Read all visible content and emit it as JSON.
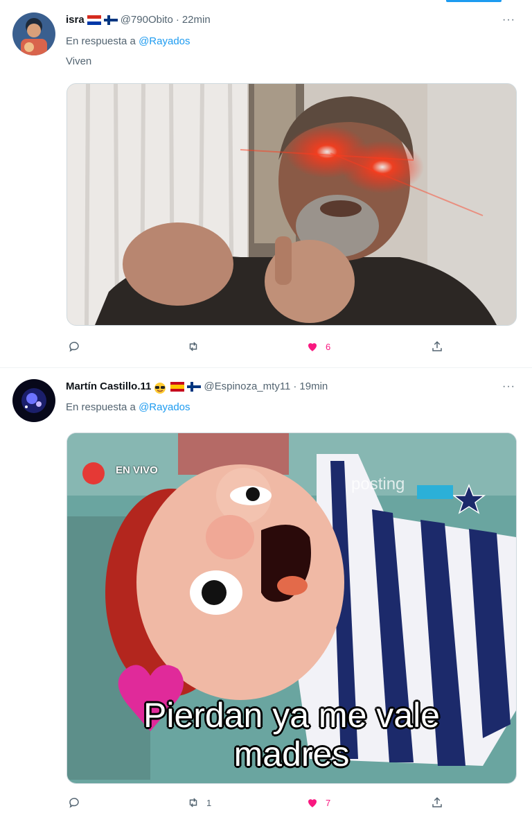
{
  "tweets": [
    {
      "name": "isra",
      "handle": "@790Obito",
      "time": "22min",
      "reply_prefix": "En respuesta a",
      "reply_to": "@Rayados",
      "text": "Viven",
      "more": "···",
      "actions": {
        "reply": "",
        "retweet": "",
        "like": "6",
        "liked": true,
        "share": ""
      }
    },
    {
      "name": "Martín Castillo.11",
      "handle": "@Espinoza_mty11",
      "time": "19min",
      "reply_prefix": "En respuesta a",
      "reply_to": "@Rayados",
      "more": "···",
      "media_caption_line1": "Pierdan ya me vale",
      "media_caption_line2": "madres",
      "media_badge": "EN VIVO",
      "media_watermark": "posting",
      "actions": {
        "reply": "",
        "retweet": "1",
        "like": "7",
        "liked": true,
        "share": ""
      }
    }
  ],
  "colors": {
    "accent": "#1d9bf0",
    "like": "#f91880",
    "muted": "#536471"
  },
  "icons": [
    "reply-icon",
    "retweet-icon",
    "like-icon",
    "share-icon",
    "more-icon"
  ]
}
